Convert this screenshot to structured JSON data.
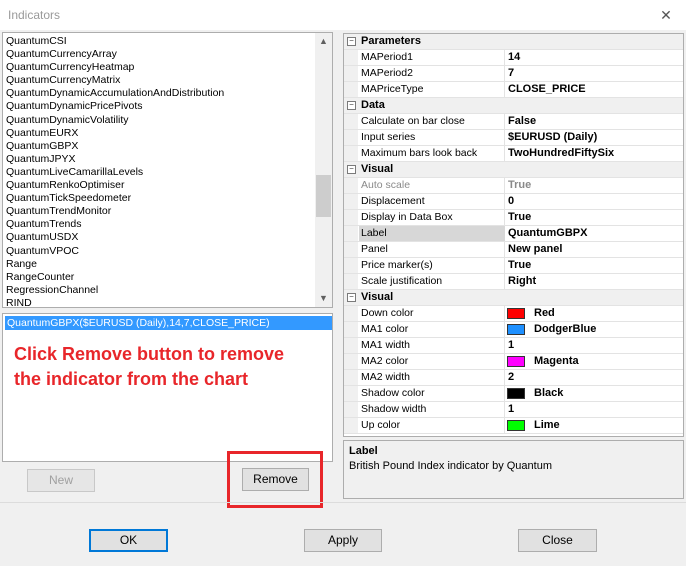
{
  "window": {
    "title": "Indicators",
    "close_glyph": "✕"
  },
  "indicator_list": {
    "items": [
      "QuantumCSI",
      "QuantumCurrencyArray",
      "QuantumCurrencyHeatmap",
      "QuantumCurrencyMatrix",
      "QuantumDynamicAccumulationAndDistribution",
      "QuantumDynamicPricePivots",
      "QuantumDynamicVolatility",
      "QuantumEURX",
      "QuantumGBPX",
      "QuantumJPYX",
      "QuantumLiveCamarillaLevels",
      "QuantumRenkoOptimiser",
      "QuantumTickSpeedometer",
      "QuantumTrendMonitor",
      "QuantumTrends",
      "QuantumUSDX",
      "QuantumVPOC",
      "Range",
      "RangeCounter",
      "RegressionChannel",
      "RIND"
    ]
  },
  "applied": {
    "selected": "QuantumGBPX($EURUSD (Daily),14,7,CLOSE_PRICE)",
    "annotation": "Click Remove button to remove the indicator from the chart"
  },
  "buttons": {
    "new": "New",
    "remove": "Remove",
    "ok": "OK",
    "apply": "Apply",
    "close": "Close"
  },
  "properties": {
    "parameters": {
      "label": "Parameters",
      "rows": [
        {
          "name": "MAPeriod1",
          "value": "14"
        },
        {
          "name": "MAPeriod2",
          "value": "7"
        },
        {
          "name": "MAPriceType",
          "value": "CLOSE_PRICE"
        }
      ]
    },
    "data": {
      "label": "Data",
      "rows": [
        {
          "name": "Calculate on bar close",
          "value": "False"
        },
        {
          "name": "Input series",
          "value": "$EURUSD (Daily)"
        },
        {
          "name": "Maximum bars look back",
          "value": "TwoHundredFiftySix"
        }
      ]
    },
    "visual": {
      "label": "Visual",
      "rows": [
        {
          "name": "Auto scale",
          "value": "True"
        },
        {
          "name": "Displacement",
          "value": "0"
        },
        {
          "name": "Display in Data Box",
          "value": "True"
        },
        {
          "name": "Label",
          "value": "QuantumGBPX"
        },
        {
          "name": "Panel",
          "value": "New panel"
        },
        {
          "name": "Price marker(s)",
          "value": "True"
        },
        {
          "name": "Scale justification",
          "value": "Right"
        }
      ]
    },
    "visual2": {
      "label": "Visual",
      "rows": [
        {
          "name": "Down color",
          "value": "Red",
          "color": "#ff0000"
        },
        {
          "name": "MA1 color",
          "value": "DodgerBlue",
          "color": "#1e90ff"
        },
        {
          "name": "MA1 width",
          "value": "1"
        },
        {
          "name": "MA2 color",
          "value": "Magenta",
          "color": "#ff00ff"
        },
        {
          "name": "MA2 width",
          "value": "2"
        },
        {
          "name": "Shadow color",
          "value": "Black",
          "color": "#000000"
        },
        {
          "name": "Shadow width",
          "value": "1"
        },
        {
          "name": "Up color",
          "value": "Lime",
          "color": "#00ff00"
        }
      ]
    },
    "collapse_glyph": "−"
  },
  "help": {
    "title": "Label",
    "description": "British Pound Index indicator by Quantum"
  }
}
